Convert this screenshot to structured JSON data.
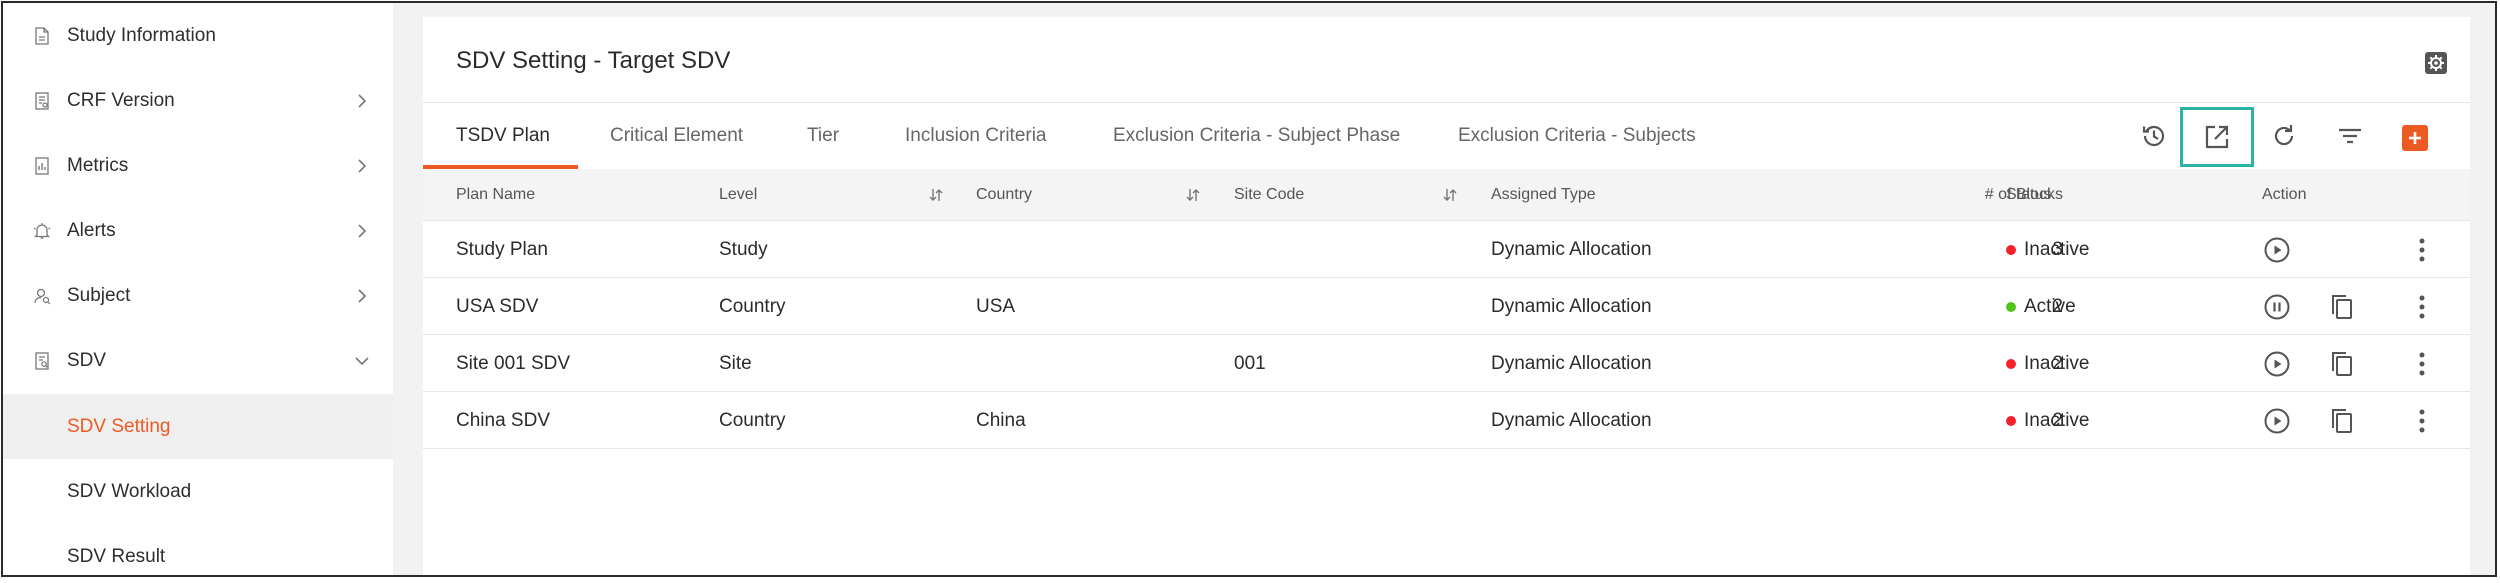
{
  "sidebar": {
    "items": [
      {
        "label": "Study Information",
        "icon": "document-icon",
        "has_chevron": false
      },
      {
        "label": "CRF Version",
        "icon": "form-icon",
        "has_chevron": true
      },
      {
        "label": "Metrics",
        "icon": "metrics-icon",
        "has_chevron": true
      },
      {
        "label": "Alerts",
        "icon": "bell-icon",
        "has_chevron": true
      },
      {
        "label": "Subject",
        "icon": "subject-icon",
        "has_chevron": true
      },
      {
        "label": "SDV",
        "icon": "sdv-icon",
        "has_chevron": true,
        "expanded": true
      }
    ],
    "sub_items": [
      {
        "label": "SDV Setting",
        "active": true
      },
      {
        "label": "SDV Workload",
        "active": false
      },
      {
        "label": "SDV Result",
        "active": false
      }
    ]
  },
  "header": {
    "title": "SDV Setting - Target SDV"
  },
  "tabs": [
    {
      "label": "TSDV Plan",
      "active": true
    },
    {
      "label": "Critical Element",
      "active": false
    },
    {
      "label": "Tier",
      "active": false
    },
    {
      "label": "Inclusion Criteria",
      "active": false
    },
    {
      "label": "Exclusion Criteria - Subject Phase",
      "active": false
    },
    {
      "label": "Exclusion Criteria - Subjects",
      "active": false
    }
  ],
  "toolbar": {
    "icons": [
      "history-icon",
      "open-external-icon",
      "refresh-icon",
      "filter-icon",
      "add-icon"
    ]
  },
  "table": {
    "columns": [
      "Plan Name",
      "Level",
      "Country",
      "Site Code",
      "Assigned Type",
      "# of Blocks",
      "Status",
      "Action"
    ],
    "rows": [
      {
        "plan_name": "Study Plan",
        "level": "Study",
        "country": "",
        "site_code": "",
        "assigned_type": "Dynamic Allocation",
        "blocks": "3",
        "status": "Inactive",
        "action": "play"
      },
      {
        "plan_name": "USA SDV",
        "level": "Country",
        "country": "USA",
        "site_code": "",
        "assigned_type": "Dynamic Allocation",
        "blocks": "2",
        "status": "Active",
        "action": "pause"
      },
      {
        "plan_name": "Site 001 SDV",
        "level": "Site",
        "country": "",
        "site_code": "001",
        "assigned_type": "Dynamic Allocation",
        "blocks": "2",
        "status": "Inactive",
        "action": "play"
      },
      {
        "plan_name": "China SDV",
        "level": "Country",
        "country": "China",
        "site_code": "",
        "assigned_type": "Dynamic Allocation",
        "blocks": "2",
        "status": "Inactive",
        "action": "play"
      }
    ]
  },
  "colors": {
    "accent": "#ee5a24",
    "highlight": "#2bb3a3",
    "active_status": "#52c41a",
    "inactive_status": "#f5222d"
  }
}
